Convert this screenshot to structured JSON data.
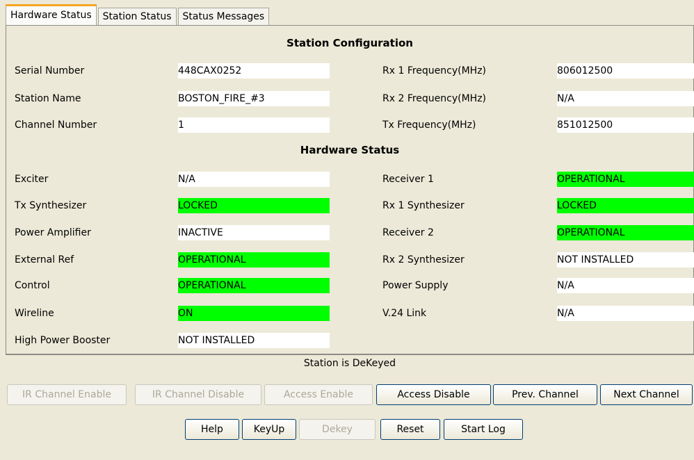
{
  "tabs": [
    "Hardware Status",
    "Station Status",
    "Status Messages"
  ],
  "station_configuration": {
    "title": "Station Configuration",
    "left": [
      {
        "label": "Serial Number",
        "value": "448CAX0252"
      },
      {
        "label": "Station Name",
        "value": "BOSTON_FIRE_#3"
      },
      {
        "label": "Channel Number",
        "value": "1"
      }
    ],
    "right": [
      {
        "label": "Rx 1 Frequency(MHz)",
        "value": "806012500"
      },
      {
        "label": "Rx 2 Frequency(MHz)",
        "value": "N/A"
      },
      {
        "label": "Tx Frequency(MHz)",
        "value": "851012500"
      }
    ]
  },
  "hardware_status": {
    "title": "Hardware Status",
    "left": [
      {
        "label": "Exciter",
        "value": "N/A",
        "highlight": false
      },
      {
        "label": "Tx Synthesizer",
        "value": "LOCKED",
        "highlight": true
      },
      {
        "label": "Power Amplifier",
        "value": "INACTIVE",
        "highlight": false
      },
      {
        "label": "External Ref",
        "value": "OPERATIONAL",
        "highlight": true
      },
      {
        "label": "Control",
        "value": "OPERATIONAL",
        "highlight": true
      },
      {
        "label": "Wireline",
        "value": "ON",
        "highlight": true
      },
      {
        "label": "High Power Booster",
        "value": "NOT INSTALLED",
        "highlight": false
      }
    ],
    "right": [
      {
        "label": "Receiver 1",
        "value": "OPERATIONAL",
        "highlight": true
      },
      {
        "label": "Rx 1 Synthesizer",
        "value": "LOCKED",
        "highlight": true
      },
      {
        "label": "Receiver 2",
        "value": "OPERATIONAL",
        "highlight": true
      },
      {
        "label": "Rx 2 Synthesizer",
        "value": "NOT INSTALLED",
        "highlight": false
      },
      {
        "label": "Power Supply",
        "value": "N/A",
        "highlight": false
      },
      {
        "label": "V.24 Link",
        "value": "N/A",
        "highlight": false
      }
    ]
  },
  "status_message": "Station is DeKeyed",
  "buttons_row1": [
    {
      "label": "IR Channel Enable",
      "enabled": false
    },
    {
      "label": "IR Channel Disable",
      "enabled": false
    },
    {
      "label": "Access Enable",
      "enabled": false
    },
    {
      "label": "Access Disable",
      "enabled": true
    },
    {
      "label": "Prev. Channel",
      "enabled": true
    },
    {
      "label": "Next Channel",
      "enabled": true
    }
  ],
  "buttons_row2": [
    {
      "label": "Help",
      "enabled": true
    },
    {
      "label": "KeyUp",
      "enabled": true
    },
    {
      "label": "Dekey",
      "enabled": false
    },
    {
      "label": "Reset",
      "enabled": true
    },
    {
      "label": "Start Log",
      "enabled": true
    }
  ],
  "colors": {
    "ok": "#00ff00",
    "tab_accent": "#f5a623"
  }
}
